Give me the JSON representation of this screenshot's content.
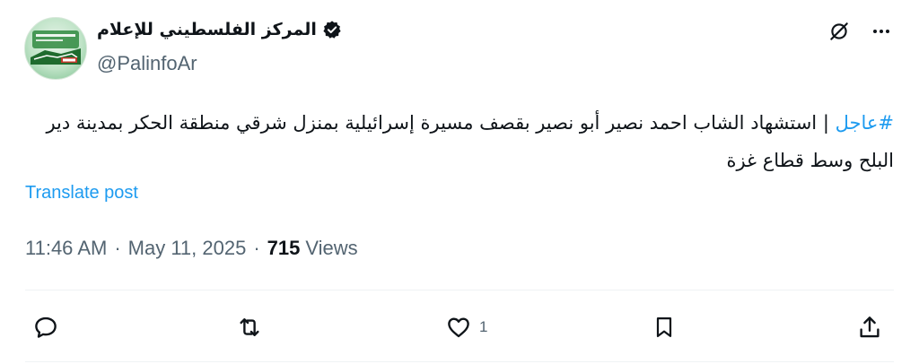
{
  "author": {
    "display_name": "المركز الفلسطيني للإعلام",
    "handle": "@PalinfoAr",
    "verified": true
  },
  "tweet": {
    "hashtag": "#عاجل",
    "separator": "|",
    "text": "استشهاد الشاب احمد نصير أبو نصير بقصف مسيرة إسرائيلية بمنزل شرقي منطقة الحكر بمدينة دير البلح وسط قطاع غزة"
  },
  "translate_label": "Translate post",
  "meta": {
    "time": "11:46 AM",
    "date": "May 11, 2025",
    "views_count": "715",
    "views_label": "Views",
    "dot": "·"
  },
  "actions": {
    "likes_count": "1"
  },
  "icons": {
    "verified": "verified-badge-icon",
    "grok": "grok-icon",
    "more": "more-icon",
    "reply": "reply-icon",
    "repost": "repost-icon",
    "like": "like-icon",
    "bookmark": "bookmark-icon",
    "share": "share-icon"
  },
  "colors": {
    "accent": "#1d9bf0",
    "text": "#0f1419",
    "muted": "#536471"
  }
}
